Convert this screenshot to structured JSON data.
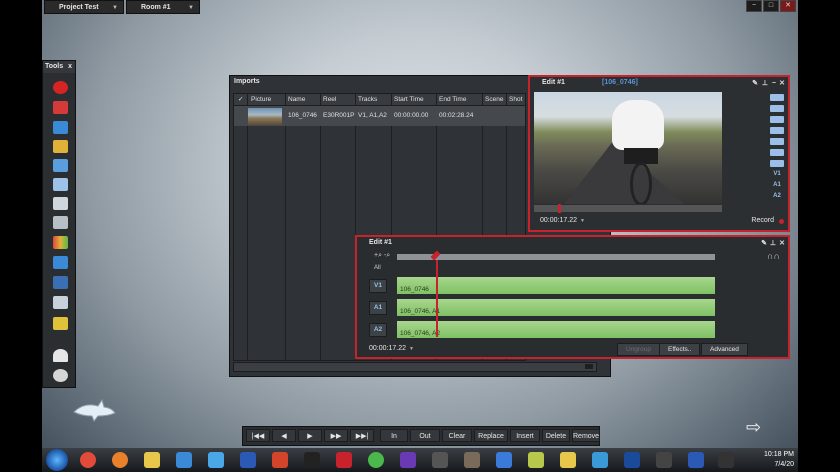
{
  "topbar": {
    "project": "Project Test",
    "room": "Room #1",
    "dropdown_arrow": "▼",
    "window_controls": [
      "−",
      "□",
      "✕"
    ]
  },
  "tools": {
    "title": "Tools",
    "close": "x"
  },
  "imports": {
    "title": "Imports",
    "columns": [
      "Picture",
      "Name",
      "Reel",
      "Tracks",
      "Start Time",
      "End Time",
      "Scene",
      "Shot"
    ],
    "row": {
      "name": "106_0746",
      "reel": "E30R001P",
      "tracks": "V1, A1,A2",
      "start": "00:00:00.00",
      "end": "00:02:28.24"
    }
  },
  "viewer": {
    "title": "Edit #1",
    "clip": "[106_0746]",
    "timecode": "00:00:17.22",
    "record": "Record",
    "track_labels": [
      "V1",
      "A1",
      "A2"
    ]
  },
  "timeline": {
    "title": "Edit #1",
    "timecode": "00:00:17.22",
    "all_label": "All",
    "tracks": [
      {
        "label": "V1",
        "clip": "106_0746"
      },
      {
        "label": "A1",
        "clip": "106_0746, A1"
      },
      {
        "label": "A2",
        "clip": "106_0746, A2"
      }
    ],
    "buttons": {
      "ungroup": "Ungroup",
      "effects": "Effects..",
      "advanced": "Advanced"
    }
  },
  "transport": {
    "nav": [
      "|◀◀",
      "◀",
      "▶",
      "▶▶",
      "▶▶|"
    ],
    "in": "In",
    "out": "Out",
    "clear": "Clear",
    "replace": "Replace",
    "insert": "Insert",
    "delete": "Delete",
    "remove": "Remove"
  },
  "taskbar": {
    "time": "10:18 PM",
    "date": "7/4/20"
  },
  "colors": {
    "accent_red": "#c8222c",
    "clip_green": "#8fcb70",
    "track_blue": "#9bbfe8",
    "clip_name_blue": "#5a92d6"
  }
}
